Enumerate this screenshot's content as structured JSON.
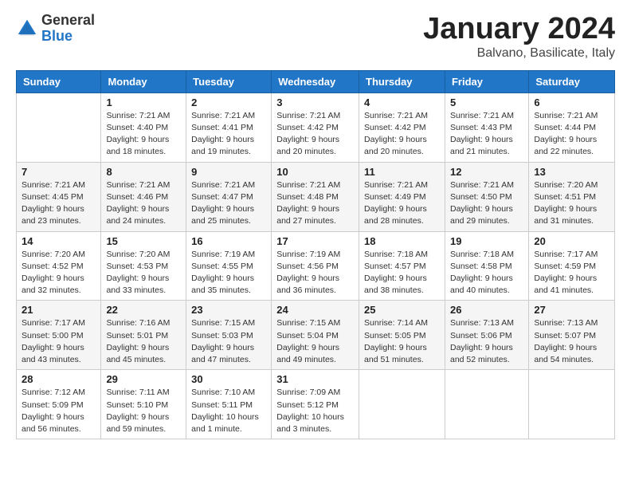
{
  "logo": {
    "general": "General",
    "blue": "Blue"
  },
  "header": {
    "month": "January 2024",
    "location": "Balvano, Basilicate, Italy"
  },
  "weekdays": [
    "Sunday",
    "Monday",
    "Tuesday",
    "Wednesday",
    "Thursday",
    "Friday",
    "Saturday"
  ],
  "weeks": [
    [
      {
        "day": "",
        "info": ""
      },
      {
        "day": "1",
        "info": "Sunrise: 7:21 AM\nSunset: 4:40 PM\nDaylight: 9 hours\nand 18 minutes."
      },
      {
        "day": "2",
        "info": "Sunrise: 7:21 AM\nSunset: 4:41 PM\nDaylight: 9 hours\nand 19 minutes."
      },
      {
        "day": "3",
        "info": "Sunrise: 7:21 AM\nSunset: 4:42 PM\nDaylight: 9 hours\nand 20 minutes."
      },
      {
        "day": "4",
        "info": "Sunrise: 7:21 AM\nSunset: 4:42 PM\nDaylight: 9 hours\nand 20 minutes."
      },
      {
        "day": "5",
        "info": "Sunrise: 7:21 AM\nSunset: 4:43 PM\nDaylight: 9 hours\nand 21 minutes."
      },
      {
        "day": "6",
        "info": "Sunrise: 7:21 AM\nSunset: 4:44 PM\nDaylight: 9 hours\nand 22 minutes."
      }
    ],
    [
      {
        "day": "7",
        "info": "Sunrise: 7:21 AM\nSunset: 4:45 PM\nDaylight: 9 hours\nand 23 minutes."
      },
      {
        "day": "8",
        "info": "Sunrise: 7:21 AM\nSunset: 4:46 PM\nDaylight: 9 hours\nand 24 minutes."
      },
      {
        "day": "9",
        "info": "Sunrise: 7:21 AM\nSunset: 4:47 PM\nDaylight: 9 hours\nand 25 minutes."
      },
      {
        "day": "10",
        "info": "Sunrise: 7:21 AM\nSunset: 4:48 PM\nDaylight: 9 hours\nand 27 minutes."
      },
      {
        "day": "11",
        "info": "Sunrise: 7:21 AM\nSunset: 4:49 PM\nDaylight: 9 hours\nand 28 minutes."
      },
      {
        "day": "12",
        "info": "Sunrise: 7:21 AM\nSunset: 4:50 PM\nDaylight: 9 hours\nand 29 minutes."
      },
      {
        "day": "13",
        "info": "Sunrise: 7:20 AM\nSunset: 4:51 PM\nDaylight: 9 hours\nand 31 minutes."
      }
    ],
    [
      {
        "day": "14",
        "info": "Sunrise: 7:20 AM\nSunset: 4:52 PM\nDaylight: 9 hours\nand 32 minutes."
      },
      {
        "day": "15",
        "info": "Sunrise: 7:20 AM\nSunset: 4:53 PM\nDaylight: 9 hours\nand 33 minutes."
      },
      {
        "day": "16",
        "info": "Sunrise: 7:19 AM\nSunset: 4:55 PM\nDaylight: 9 hours\nand 35 minutes."
      },
      {
        "day": "17",
        "info": "Sunrise: 7:19 AM\nSunset: 4:56 PM\nDaylight: 9 hours\nand 36 minutes."
      },
      {
        "day": "18",
        "info": "Sunrise: 7:18 AM\nSunset: 4:57 PM\nDaylight: 9 hours\nand 38 minutes."
      },
      {
        "day": "19",
        "info": "Sunrise: 7:18 AM\nSunset: 4:58 PM\nDaylight: 9 hours\nand 40 minutes."
      },
      {
        "day": "20",
        "info": "Sunrise: 7:17 AM\nSunset: 4:59 PM\nDaylight: 9 hours\nand 41 minutes."
      }
    ],
    [
      {
        "day": "21",
        "info": "Sunrise: 7:17 AM\nSunset: 5:00 PM\nDaylight: 9 hours\nand 43 minutes."
      },
      {
        "day": "22",
        "info": "Sunrise: 7:16 AM\nSunset: 5:01 PM\nDaylight: 9 hours\nand 45 minutes."
      },
      {
        "day": "23",
        "info": "Sunrise: 7:15 AM\nSunset: 5:03 PM\nDaylight: 9 hours\nand 47 minutes."
      },
      {
        "day": "24",
        "info": "Sunrise: 7:15 AM\nSunset: 5:04 PM\nDaylight: 9 hours\nand 49 minutes."
      },
      {
        "day": "25",
        "info": "Sunrise: 7:14 AM\nSunset: 5:05 PM\nDaylight: 9 hours\nand 51 minutes."
      },
      {
        "day": "26",
        "info": "Sunrise: 7:13 AM\nSunset: 5:06 PM\nDaylight: 9 hours\nand 52 minutes."
      },
      {
        "day": "27",
        "info": "Sunrise: 7:13 AM\nSunset: 5:07 PM\nDaylight: 9 hours\nand 54 minutes."
      }
    ],
    [
      {
        "day": "28",
        "info": "Sunrise: 7:12 AM\nSunset: 5:09 PM\nDaylight: 9 hours\nand 56 minutes."
      },
      {
        "day": "29",
        "info": "Sunrise: 7:11 AM\nSunset: 5:10 PM\nDaylight: 9 hours\nand 59 minutes."
      },
      {
        "day": "30",
        "info": "Sunrise: 7:10 AM\nSunset: 5:11 PM\nDaylight: 10 hours\nand 1 minute."
      },
      {
        "day": "31",
        "info": "Sunrise: 7:09 AM\nSunset: 5:12 PM\nDaylight: 10 hours\nand 3 minutes."
      },
      {
        "day": "",
        "info": ""
      },
      {
        "day": "",
        "info": ""
      },
      {
        "day": "",
        "info": ""
      }
    ]
  ]
}
